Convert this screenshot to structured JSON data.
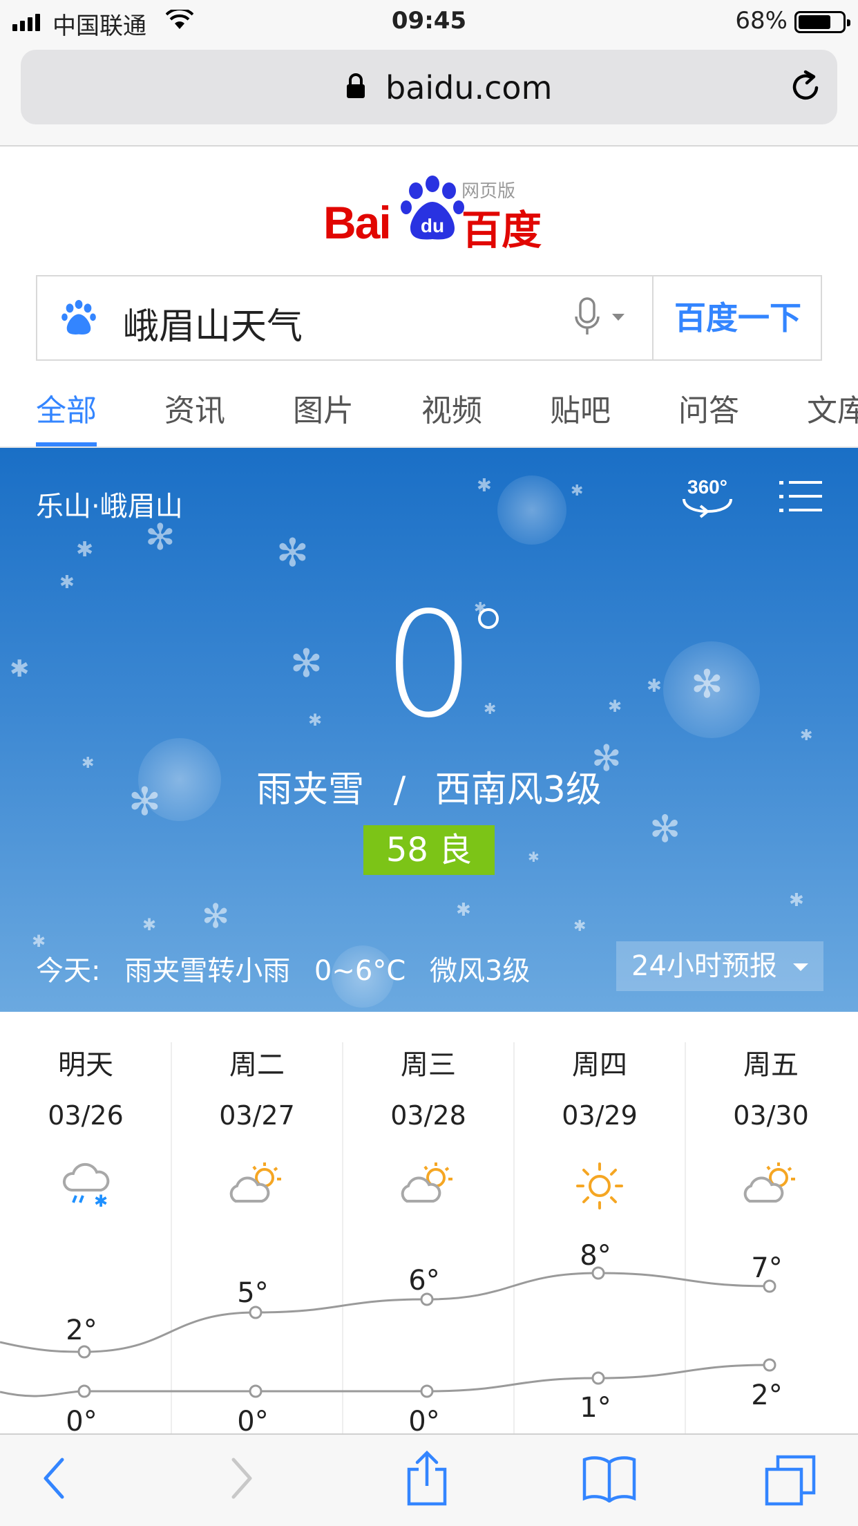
{
  "status": {
    "carrier": "中国联通",
    "time": "09:45",
    "battery": "68%",
    "battery_level": 0.68
  },
  "url": {
    "domain": "baidu.com"
  },
  "logo": {
    "text_en": "Bai",
    "text_du": "du",
    "text_cn": "百度",
    "version": "网页版"
  },
  "search": {
    "query": "峨眉山天气",
    "button": "百度一下"
  },
  "tabs": [
    {
      "label": "全部",
      "active": true
    },
    {
      "label": "资讯"
    },
    {
      "label": "图片"
    },
    {
      "label": "视频"
    },
    {
      "label": "贴吧"
    },
    {
      "label": "问答"
    },
    {
      "label": "文库"
    }
  ],
  "weather": {
    "location": "乐山·峨眉山",
    "temp": "0",
    "condition": "雨夹雪",
    "separator": "/",
    "wind": "西南风3级",
    "aqi": "58 良",
    "aqi_color": "#7cc417",
    "today_label": "今天:",
    "today_condition": "雨夹雪转小雨",
    "today_range": "0~6°C",
    "today_wind": "微风3级",
    "forecast_button": "24小时预报"
  },
  "forecast": {
    "days": [
      {
        "name": "明天",
        "date": "03/26",
        "icon": "sleet-icon",
        "high": "2°",
        "low": "0°"
      },
      {
        "name": "周二",
        "date": "03/27",
        "icon": "partly-cloudy-icon",
        "high": "5°",
        "low": "0°"
      },
      {
        "name": "周三",
        "date": "03/28",
        "icon": "partly-cloudy-icon",
        "high": "6°",
        "low": "0°"
      },
      {
        "name": "周四",
        "date": "03/29",
        "icon": "sunny-icon",
        "high": "8°",
        "low": "1°"
      },
      {
        "name": "周五",
        "date": "03/30",
        "icon": "partly-cloudy-icon",
        "high": "7°",
        "low": "2°"
      }
    ],
    "high_values": [
      2,
      5,
      6,
      8,
      7
    ],
    "low_values": [
      0,
      0,
      0,
      1,
      2
    ]
  },
  "colors": {
    "accent": "#3385ff",
    "brand_red": "#e10601",
    "sun": "#f5a623",
    "rain": "#1e90ff"
  }
}
